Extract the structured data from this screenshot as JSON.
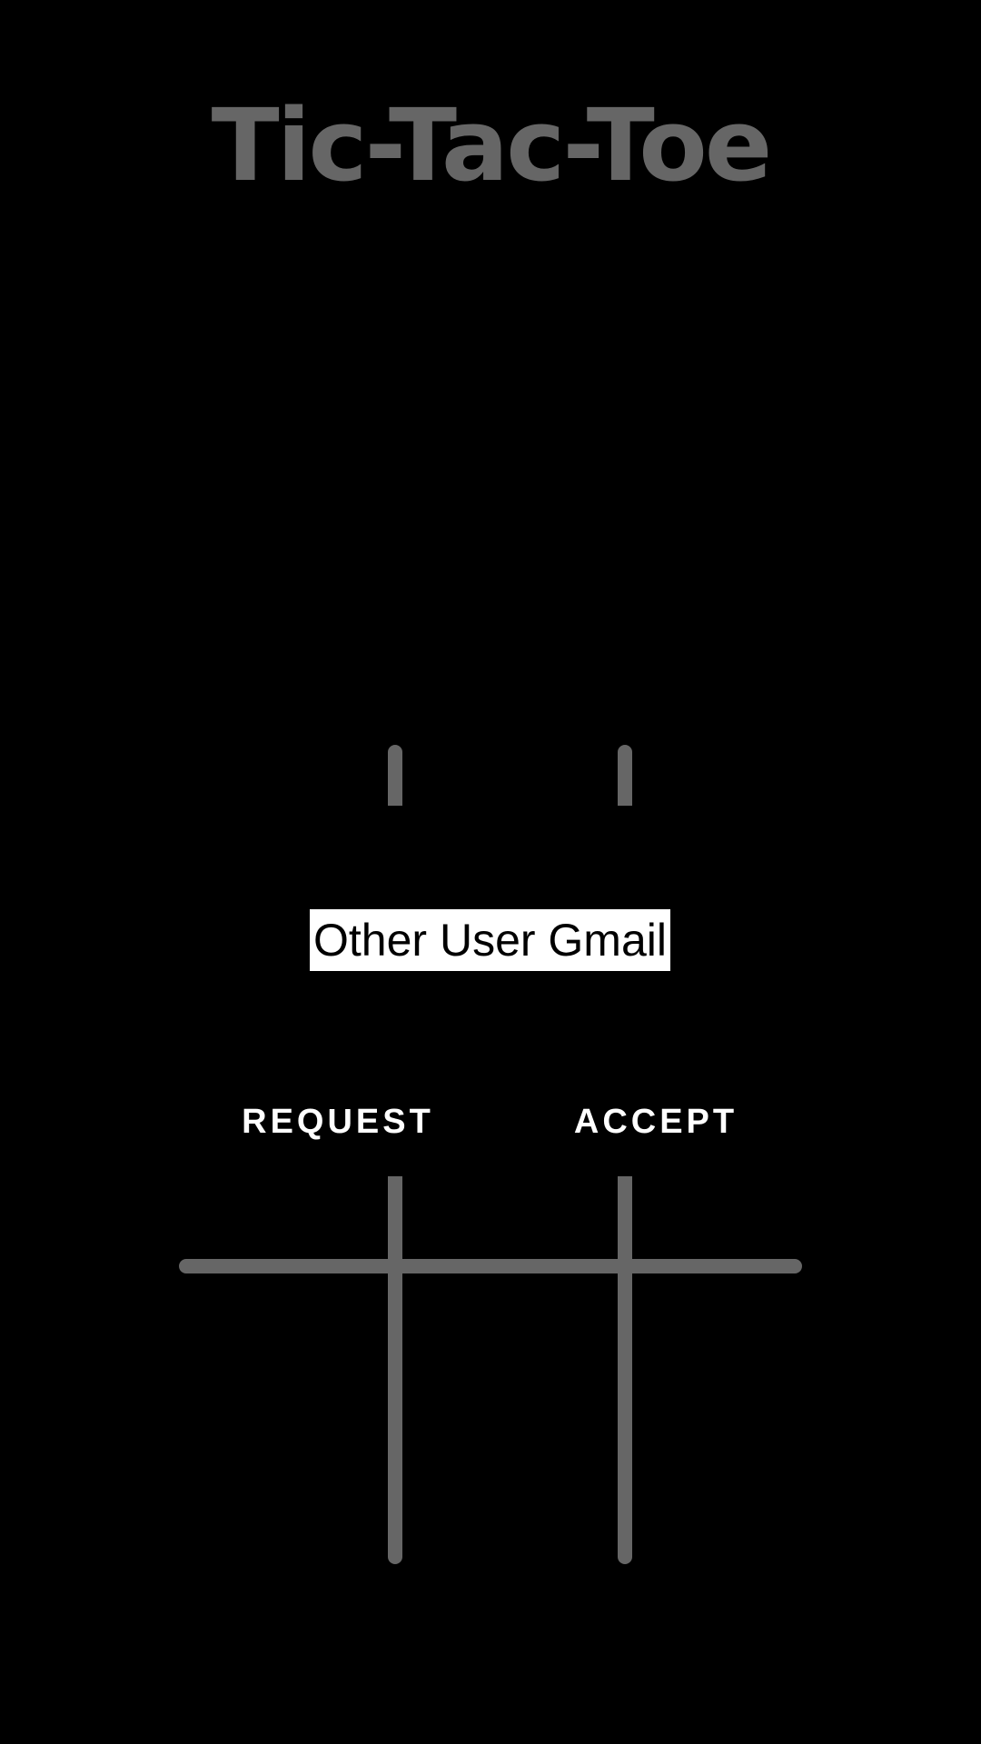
{
  "app": {
    "title": "Tic-Tac-Toe"
  },
  "board": {
    "line_color": "#666666",
    "background_color": "#000000"
  },
  "dialog": {
    "email_input": {
      "value": "",
      "placeholder": "Other User Gmail"
    },
    "request_label": "REQUEST",
    "accept_label": "ACCEPT",
    "text_color": "#ffffff"
  }
}
